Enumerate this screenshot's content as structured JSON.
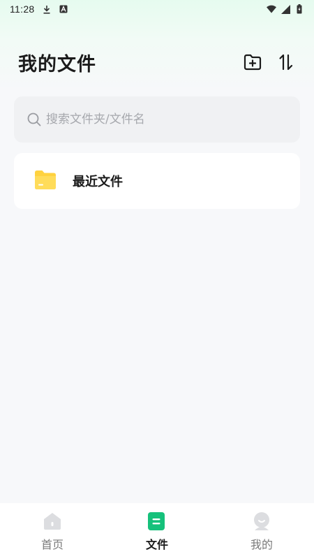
{
  "status_bar": {
    "time": "11:28",
    "left_icons": [
      "download-icon",
      "a-box-icon"
    ],
    "right_icons": [
      "wifi-icon",
      "signal-icon",
      "battery-icon"
    ]
  },
  "header": {
    "title": "我的文件",
    "actions": [
      "new-folder-icon",
      "sort-icon"
    ]
  },
  "search": {
    "placeholder": "搜索文件夹/文件名",
    "value": ""
  },
  "folders": [
    {
      "label": "最近文件",
      "icon": "folder-icon",
      "color": "#ffd23f"
    }
  ],
  "bottom_nav": {
    "items": [
      {
        "label": "首页",
        "icon": "home-icon",
        "active": false
      },
      {
        "label": "文件",
        "icon": "file-icon",
        "active": true
      },
      {
        "label": "我的",
        "icon": "profile-icon",
        "active": false
      }
    ]
  },
  "colors": {
    "accent": "#16c17b",
    "folder": "#ffd23f",
    "inactive_icon": "#dcdde0",
    "background": "#f7f8fa"
  }
}
